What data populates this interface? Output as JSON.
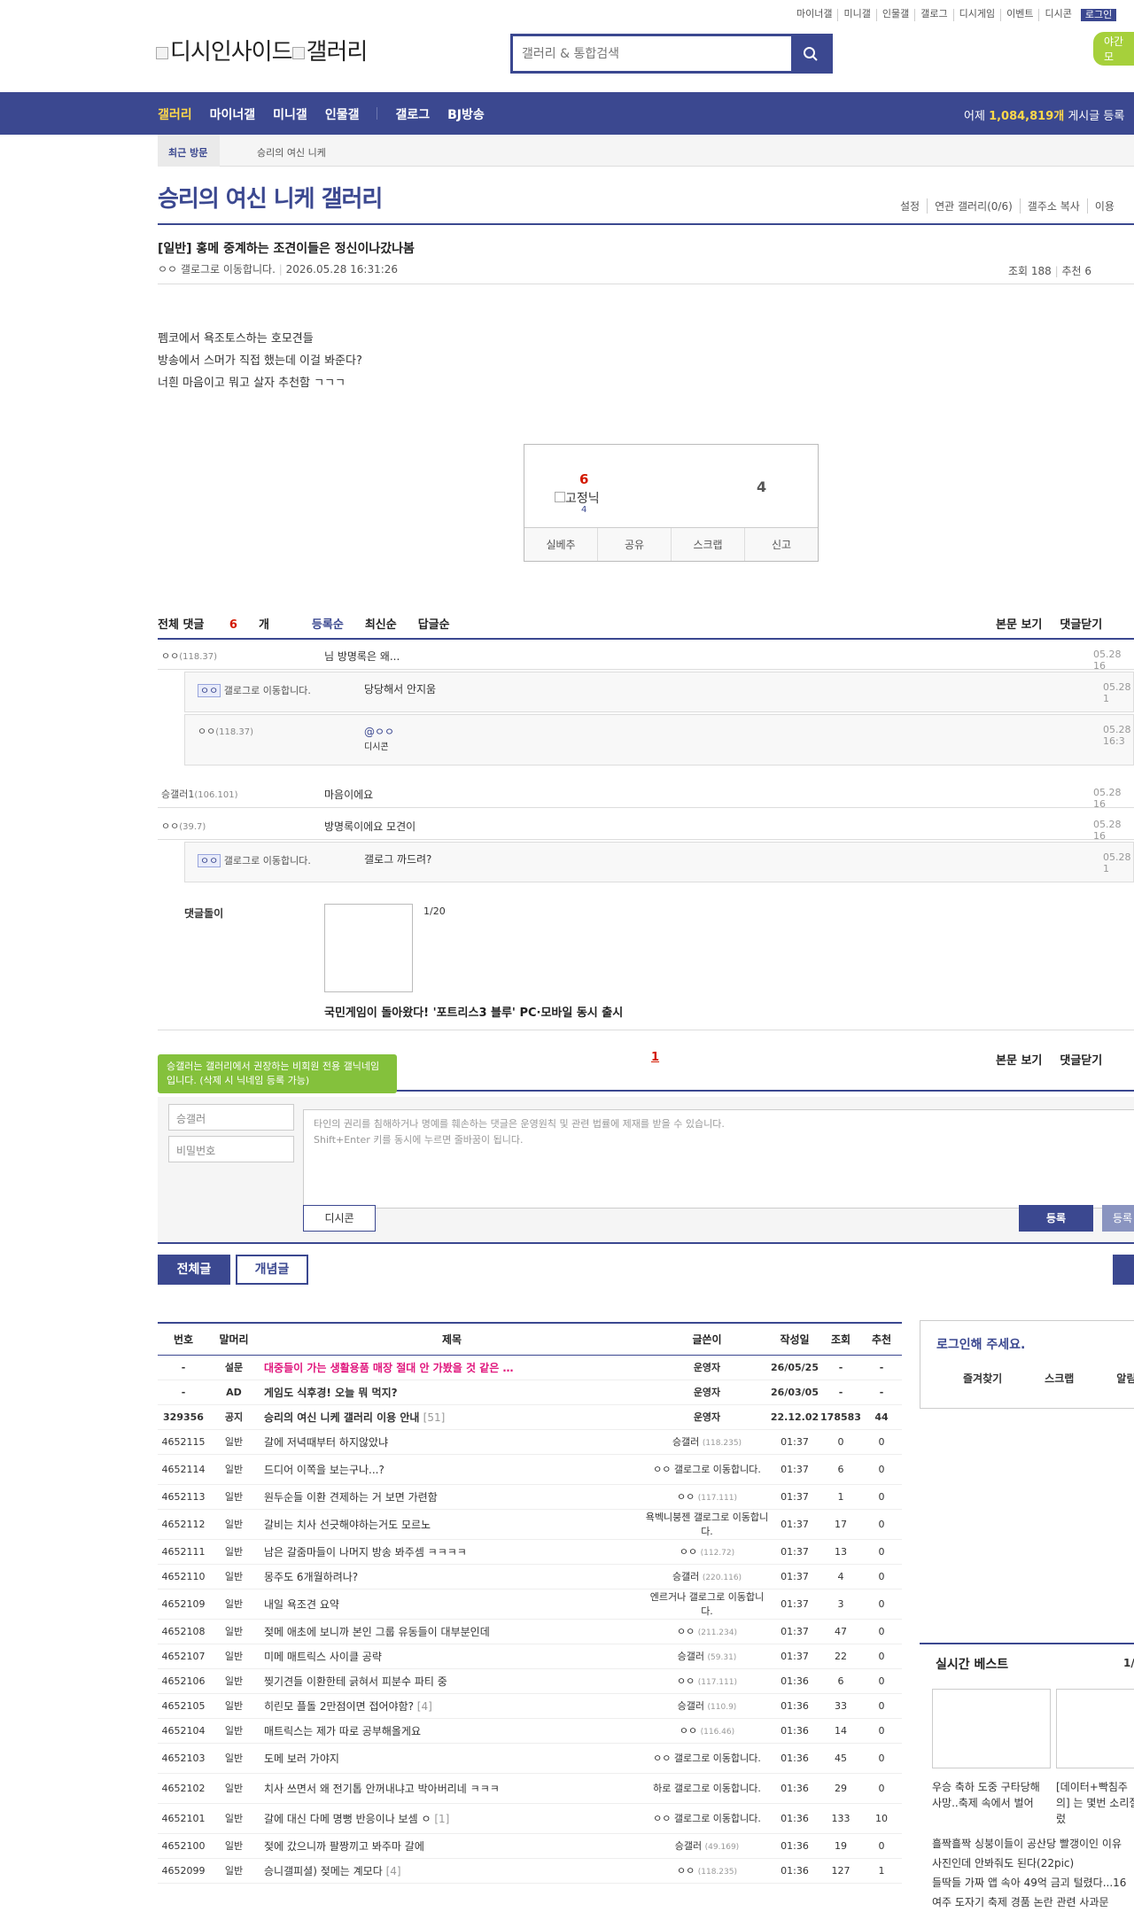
{
  "top": {
    "links": [
      "마이너갤",
      "미니갤",
      "인물갤",
      "갤로그",
      "디시게임",
      "이벤트",
      "디시콘"
    ],
    "login": "로그인",
    "night": "야간 모"
  },
  "logo": {
    "left": "디시인사이드",
    "right": "갤러리"
  },
  "search": {
    "placeholder": "갤러리 & 통합검색"
  },
  "gnb": {
    "items": [
      "갤러리",
      "마이너갤",
      "미니갤",
      "인물갤",
      "갤로그",
      "BJ방송"
    ],
    "count_pre": "어제 ",
    "count": "1,084,819개",
    "count_post": " 게시글 등록"
  },
  "visit": {
    "label": "최근 방문",
    "gallery": "승리의 여신 니케"
  },
  "gallery": {
    "title": "승리의 여신 니케 갤러리",
    "menu": [
      "설정",
      "연관 갤러리(0/6)",
      "갤주소 복사",
      "이용"
    ]
  },
  "post": {
    "title": "[일반] 홍메 중계하는 조견이들은 정신이나갔나봄",
    "author": "ㅇㅇ",
    "author_img": "갤로그로 이동합니다.",
    "date": "2026.05.28 16:31:26",
    "views": "조회 188",
    "recommend": "추천 6",
    "body": [
      "펨코에서 욕조토스하는 호모견들",
      "방송에서 스머가 직접 했는데 이걸 봐준다?",
      "너흰 마음이고 뭐고 살자 추천함 ㄱㄱㄱ"
    ],
    "up": "6",
    "up_img": "고정닉",
    "up_fixed": "4",
    "down": "4",
    "actions": [
      "실베추",
      "공유",
      "스크랩",
      "신고"
    ]
  },
  "comments": {
    "head": {
      "all": "전체 댓글 ",
      "count": "6",
      "unit": "개",
      "sorts": [
        "등록순",
        "최신순",
        "답글순"
      ]
    },
    "right": [
      "본문 보기",
      "댓글닫기"
    ],
    "items": [
      {
        "nick": "ㅇㅇ",
        "ip": "(118.37)",
        "text": "님 방명록은 왜...",
        "date": "05.28 16"
      },
      {
        "nick": "ㅇㅇ",
        "img": "갤로그로 이동합니다.",
        "text": "당당해서 안지움",
        "date": "05.28 1"
      },
      {
        "nick": "ㅇㅇ",
        "ip": "(118.37)",
        "text": "@ㅇㅇ",
        "text2": "디시콘",
        "date": "05.28 16:3"
      },
      {
        "nick": "승갤러1",
        "ip": "(106.101)",
        "text": "마음이에요",
        "date": "05.28 16"
      },
      {
        "nick": "ㅇㅇ",
        "ip": "(39.7)",
        "text": "방명록이에요 모견이",
        "date": "05.28 16"
      },
      {
        "nick": "ㅇㅇ",
        "img": "갤로그로 이동합니다.",
        "text": "갤로그 까드려?",
        "date": "05.28 1"
      }
    ],
    "dlg": "댓글돌이",
    "dlg_page": "1/20",
    "dlg_title": "국민게임이 돌아왔다! '포트리스3 블루' PC·모바일 동시 출시",
    "page": "1"
  },
  "form": {
    "tooltip": "승갤러는 갤러리에서 권장하는 비회원 전용 갤닉네임입니다. (삭제 시 닉네임 등록 가능)",
    "nick": "승갤러",
    "pw": "비밀번호",
    "notice1": "타인의 권리를 침해하거나 명예를 훼손하는 댓글은 운영원칙 및 관련 법률에 제재를 받을 수 있습니다.",
    "notice2": "Shift+Enter 키를 동시에 누르면 줄바꿈이 됩니다.",
    "dccon": "디시콘",
    "submit": "등록",
    "submit2": "등록"
  },
  "list": {
    "buttons": [
      "전체글",
      "개념글"
    ],
    "headers": [
      "번호",
      "말머리",
      "제목",
      "글쓴이",
      "작성일",
      "조회",
      "추천"
    ],
    "rows": [
      {
        "no": "-",
        "h": "설문",
        "title": "대중들이 가는 생활용품 매장 절대 안 가봤을 것 같은 …",
        "writer": "운영자",
        "ip": "",
        "date": "26/05/25",
        "views": "-",
        "rec": "-",
        "notice": true,
        "red": true
      },
      {
        "no": "-",
        "h": "AD",
        "title": "게임도 식후경! 오늘 뭐 먹지?",
        "writer": "운영자",
        "ip": "",
        "date": "26/03/05",
        "views": "-",
        "rec": "-",
        "notice": true
      },
      {
        "no": "329356",
        "h": "공지",
        "title": "승리의 여신 니케 갤러리 이용 안내",
        "cc": "[51]",
        "writer": "운영자",
        "ip": "",
        "date": "22.12.02",
        "views": "178583",
        "rec": "44",
        "notice": true
      },
      {
        "no": "4652115",
        "h": "일반",
        "title": "갈에 저녁때부터 하지않았냐",
        "writer": "승갤러",
        "ip": "(118.235)",
        "date": "01:37",
        "views": "0",
        "rec": "0"
      },
      {
        "no": "4652114",
        "h": "일반",
        "title": "드디어 이쪽을 보는구나...?",
        "writer": "ㅇㅇ 갤로그로 이동합니다.",
        "ip": "",
        "date": "01:37",
        "views": "6",
        "rec": "0",
        "tall": true
      },
      {
        "no": "4652113",
        "h": "일반",
        "title": "원두순들 이환 견제하는 거 보면 가련함",
        "writer": "ㅇㅇ",
        "ip": "(117.111)",
        "date": "01:37",
        "views": "1",
        "rec": "0"
      },
      {
        "no": "4652112",
        "h": "일반",
        "title": "갈비는 치사 선긋해야하는거도 모르노",
        "writer": "욕벡니붕젠 갤로그로 이동합니다.",
        "ip": "",
        "date": "01:37",
        "views": "17",
        "rec": "0",
        "tall": true
      },
      {
        "no": "4652111",
        "h": "일반",
        "title": "남은 갈줌마들이 나머지 방송 봐주셈 ㅋㅋㅋㅋ",
        "writer": "ㅇㅇ",
        "ip": "(112.72)",
        "date": "01:37",
        "views": "13",
        "rec": "0"
      },
      {
        "no": "4652110",
        "h": "일반",
        "title": "몽주도 6개월하려나?",
        "writer": "승갤러",
        "ip": "(220.116)",
        "date": "01:37",
        "views": "4",
        "rec": "0"
      },
      {
        "no": "4652109",
        "h": "일반",
        "title": "내일 욕조견 요약",
        "writer": "엔르거나 갤로그로 이동합니다.",
        "ip": "",
        "date": "01:37",
        "views": "3",
        "rec": "0",
        "tall": true
      },
      {
        "no": "4652108",
        "h": "일반",
        "title": "젖메 애초에 보니까 본인 그룹 유동들이 대부분인데",
        "writer": "ㅇㅇ",
        "ip": "(211.234)",
        "date": "01:37",
        "views": "47",
        "rec": "0"
      },
      {
        "no": "4652107",
        "h": "일반",
        "title": "미메 매트릭스 사이클 공략",
        "writer": "승갤러",
        "ip": "(59.31)",
        "date": "01:37",
        "views": "22",
        "rec": "0"
      },
      {
        "no": "4652106",
        "h": "일반",
        "title": "찢기견들 이환한테 긁혀서 피분수 파티 중",
        "writer": "ㅇㅇ",
        "ip": "(117.111)",
        "date": "01:36",
        "views": "6",
        "rec": "0"
      },
      {
        "no": "4652105",
        "h": "일반",
        "title": "히린모 플돌 2만점이면 접어야함?",
        "cc": "[4]",
        "writer": "승갤러",
        "ip": "(110.9)",
        "date": "01:36",
        "views": "33",
        "rec": "0"
      },
      {
        "no": "4652104",
        "h": "일반",
        "title": "매트릭스는 제가 따로 공부해올게요",
        "writer": "ㅇㅇ",
        "ip": "(116.46)",
        "date": "01:36",
        "views": "14",
        "rec": "0"
      },
      {
        "no": "4652103",
        "h": "일반",
        "title": "도메 보러 가야지",
        "writer": "ㅇㅇ 갤로그로 이동합니다.",
        "ip": "",
        "date": "01:36",
        "views": "45",
        "rec": "0",
        "tall": true
      },
      {
        "no": "4652102",
        "h": "일반",
        "title": "치사 쓰면서 왜 전기톱 안꺼내냐고 박아버리네 ㅋㅋㅋ",
        "writer": "하로 갤로그로 이동합니다.",
        "ip": "",
        "date": "01:36",
        "views": "29",
        "rec": "0",
        "tall": true
      },
      {
        "no": "4652101",
        "h": "일반",
        "title": "갈에 대신 다메 명뻥 반응이나 보셈 ㅇ",
        "cc": "[1]",
        "writer": "ㅇㅇ 갤로그로 이동합니다.",
        "ip": "",
        "date": "01:36",
        "views": "133",
        "rec": "10",
        "tall": true
      },
      {
        "no": "4652100",
        "h": "일반",
        "title": "젖에 갔으니까 팔짱끼고 봐주마 갈에",
        "writer": "승갤러",
        "ip": "(49.169)",
        "date": "01:36",
        "views": "19",
        "rec": "0"
      },
      {
        "no": "4652099",
        "h": "일반",
        "title": "승니갤피셜) 젖메는 계모다",
        "cc": "[4]",
        "writer": "ㅇㅇ",
        "ip": "(118.235)",
        "date": "01:36",
        "views": "127",
        "rec": "1"
      }
    ]
  },
  "side": {
    "login_title": "로그인해 주세요.",
    "links": [
      "즐겨찾기",
      "스크랩",
      "알림"
    ],
    "best_title": "실시간 베스트",
    "best_page": "1/",
    "caps": [
      "우승 축하 도중 구타당해 사망..축제 속에서 벌어",
      "[데이터+빡침주의] 는 몇번 소리질렀"
    ],
    "lines": [
      "흘짝흘짝 싱붕이들이 공산당 빨갱이인 이유",
      "사진인데 안봐줘도 된다(22pic)",
      "들딱들 가짜 앱 속아 49억 금괴 털렸다...16",
      "여주 도자기 축제 경품 논란 관련 사과문"
    ]
  }
}
